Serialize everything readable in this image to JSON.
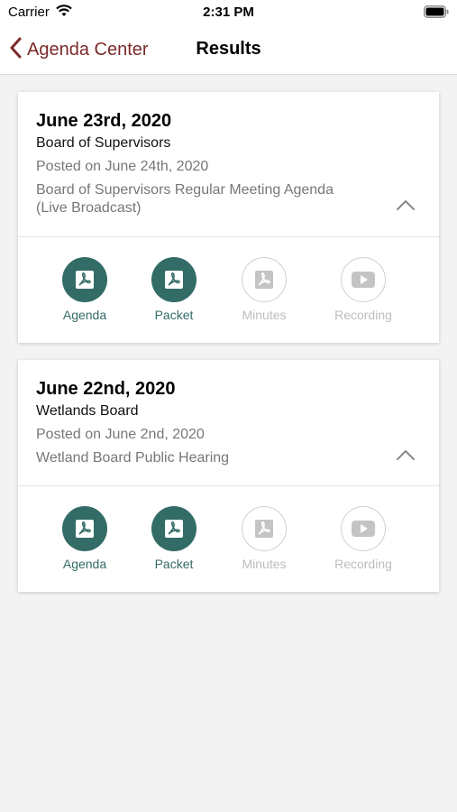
{
  "status": {
    "carrier": "Carrier",
    "time": "2:31 PM"
  },
  "nav": {
    "back_label": "Agenda Center",
    "title": "Results"
  },
  "meetings": [
    {
      "date": "June 23rd, 2020",
      "body": "Board of Supervisors",
      "posted": "Posted on June 24th, 2020",
      "description": "Board of Supervisors Regular Meeting Agenda (Live Broadcast)",
      "actions": [
        {
          "label": "Agenda",
          "icon": "pdf-icon",
          "enabled": true
        },
        {
          "label": "Packet",
          "icon": "pdf-icon",
          "enabled": true
        },
        {
          "label": "Minutes",
          "icon": "pdf-icon",
          "enabled": false
        },
        {
          "label": "Recording",
          "icon": "play-icon",
          "enabled": false
        }
      ]
    },
    {
      "date": "June 22nd, 2020",
      "body": "Wetlands Board",
      "posted": "Posted on June 2nd, 2020",
      "description": "Wetland Board Public Hearing",
      "actions": [
        {
          "label": "Agenda",
          "icon": "pdf-icon",
          "enabled": true
        },
        {
          "label": "Packet",
          "icon": "pdf-icon",
          "enabled": true
        },
        {
          "label": "Minutes",
          "icon": "pdf-icon",
          "enabled": false
        },
        {
          "label": "Recording",
          "icon": "play-icon",
          "enabled": false
        }
      ]
    }
  ],
  "colors": {
    "accent": "#336b67",
    "back_link": "#7b2a2a",
    "disabled": "#bdbdbd",
    "background": "#f3f3f3"
  }
}
